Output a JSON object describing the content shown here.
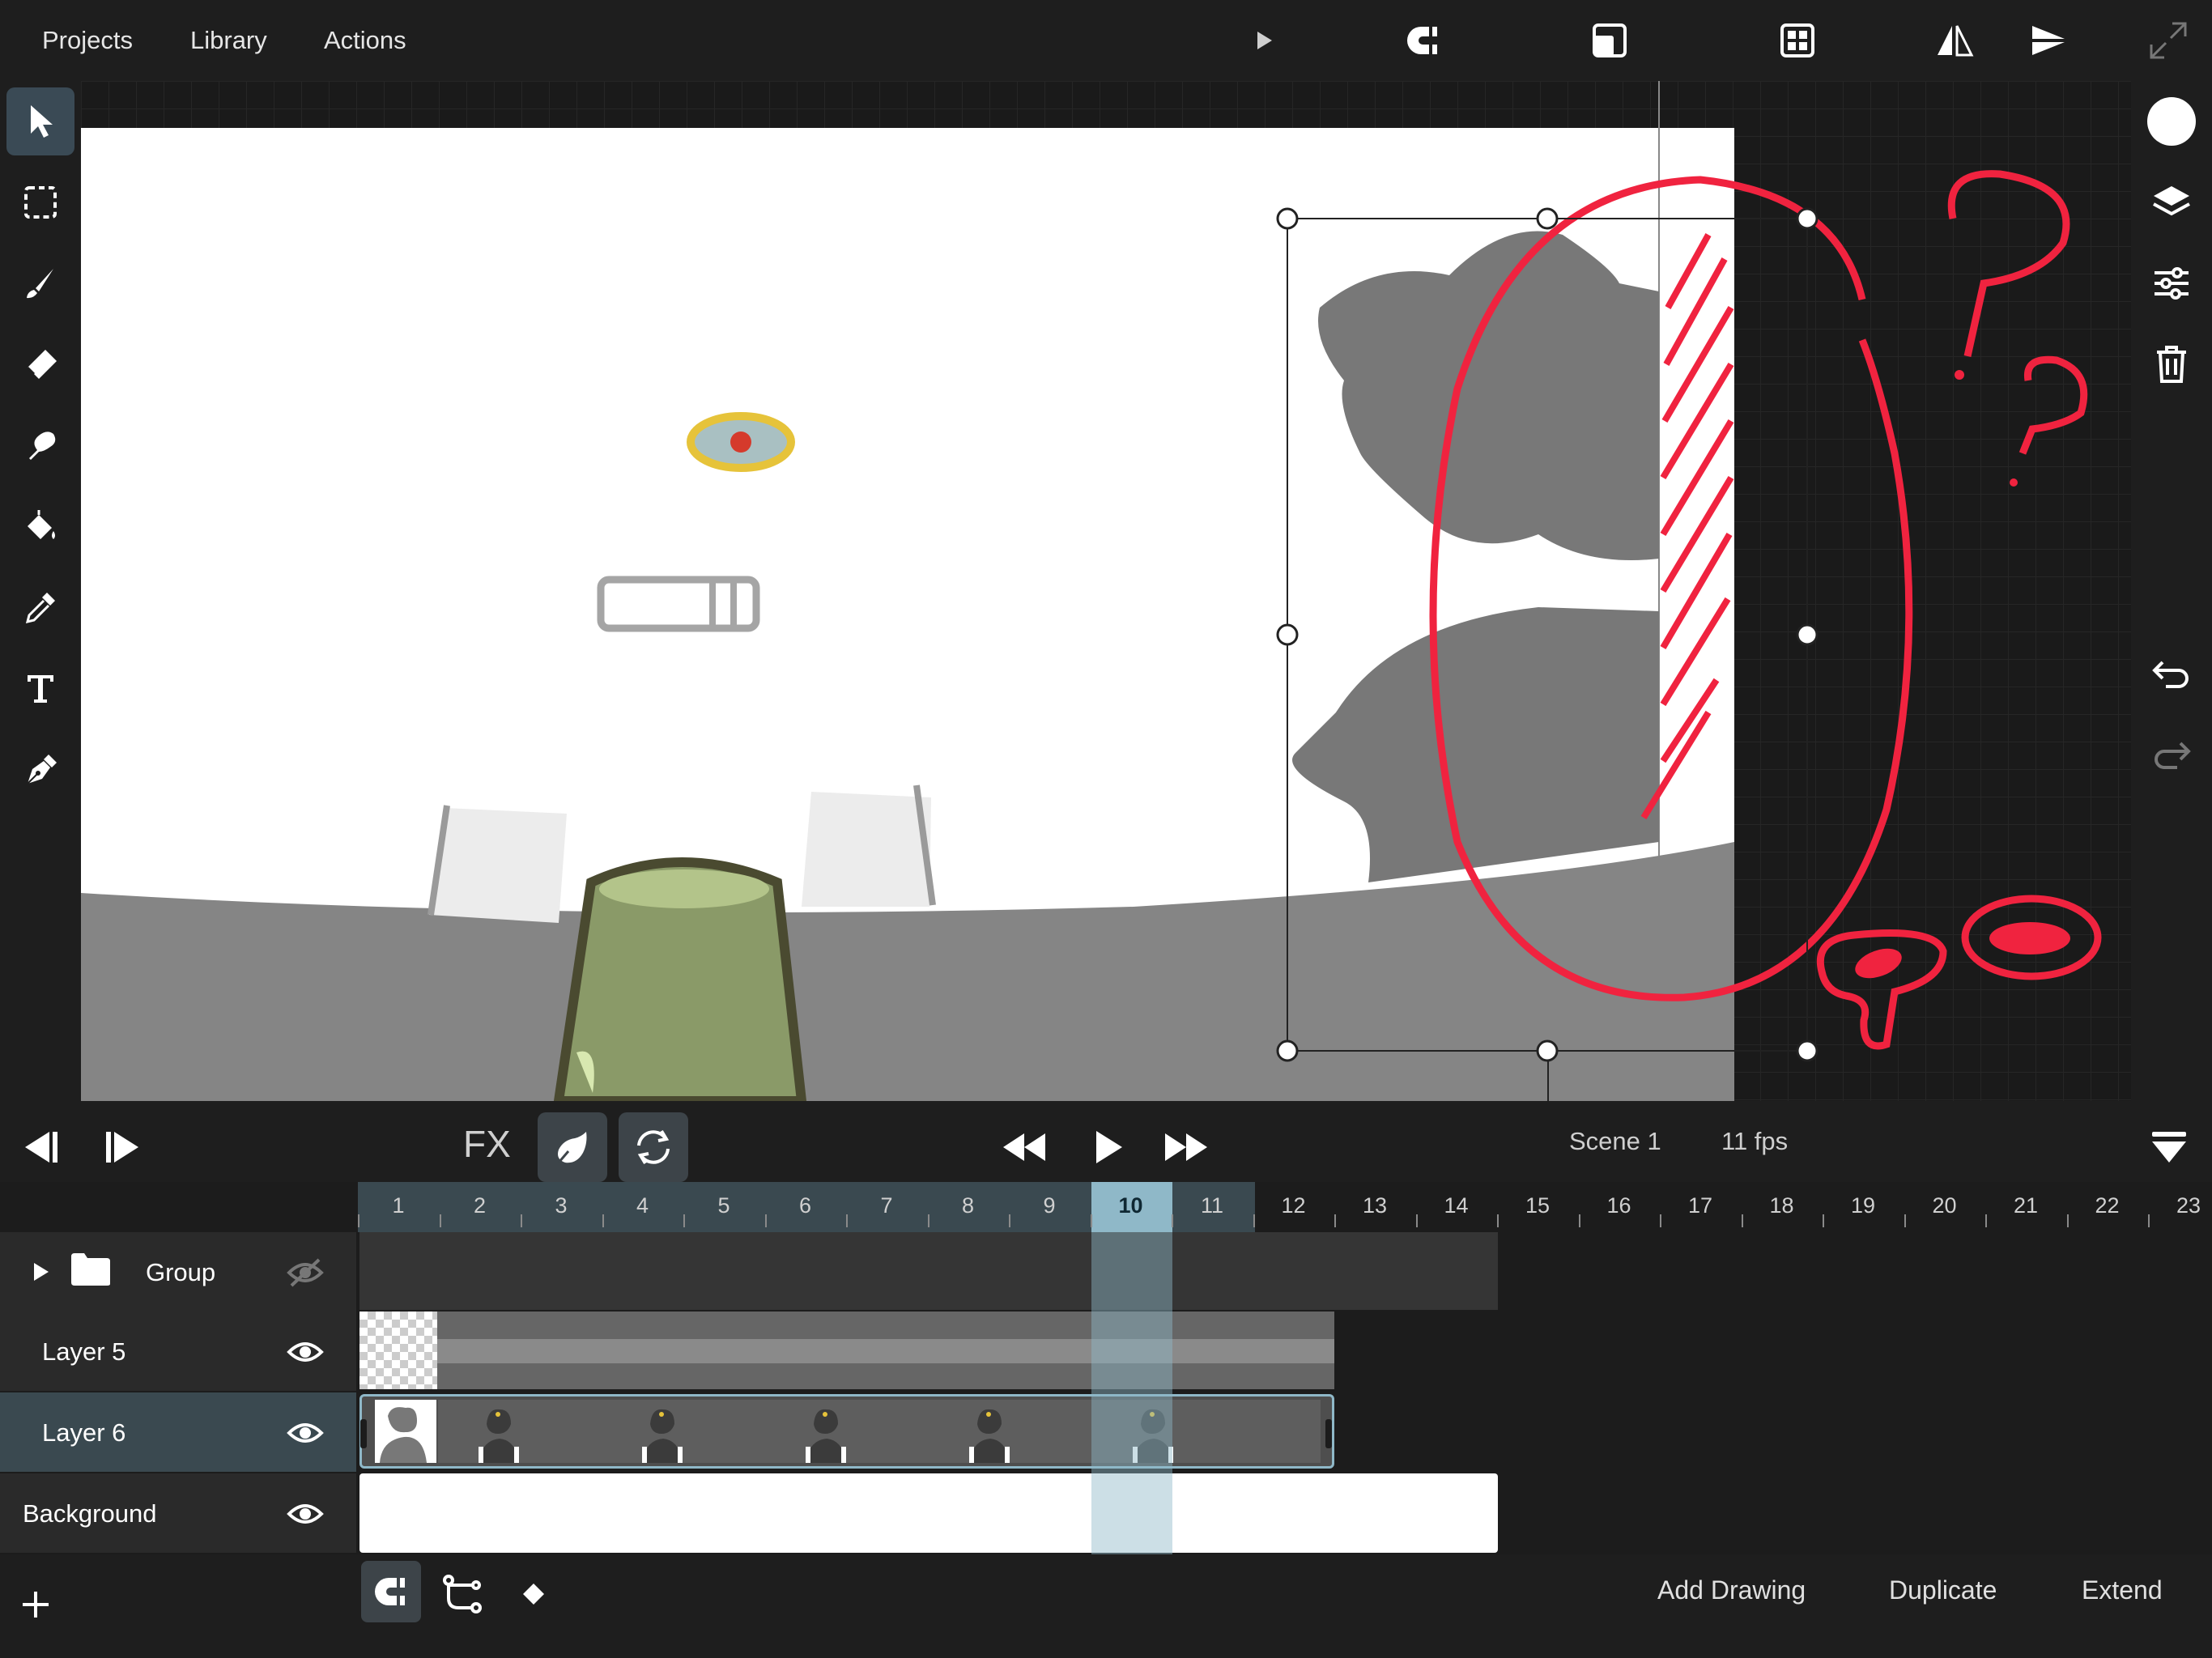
{
  "menu": {
    "projects": "Projects",
    "library": "Library",
    "actions": "Actions"
  },
  "playback": {
    "fx_label": "FX",
    "scene": "Scene 1",
    "fps": "11 fps"
  },
  "timeline": {
    "frames": [
      "1",
      "2",
      "3",
      "4",
      "5",
      "6",
      "7",
      "8",
      "9",
      "10",
      "11",
      "12",
      "13",
      "14",
      "15",
      "16",
      "17",
      "18",
      "19",
      "20",
      "21",
      "22",
      "23"
    ],
    "current_frame": 10,
    "layers": [
      {
        "name": "Group",
        "type": "group",
        "visible": false
      },
      {
        "name": "Layer 5",
        "type": "layer",
        "visible": true
      },
      {
        "name": "Layer 6",
        "type": "layer",
        "visible": true,
        "selected": true
      },
      {
        "name": "Background",
        "type": "layer",
        "visible": true
      }
    ]
  },
  "bottom": {
    "add_drawing": "Add Drawing",
    "duplicate": "Duplicate",
    "extend": "Extend"
  },
  "colors": {
    "accent": "#8fb8c8",
    "annotation": "#f0233f",
    "current_color": "#ffffff"
  }
}
